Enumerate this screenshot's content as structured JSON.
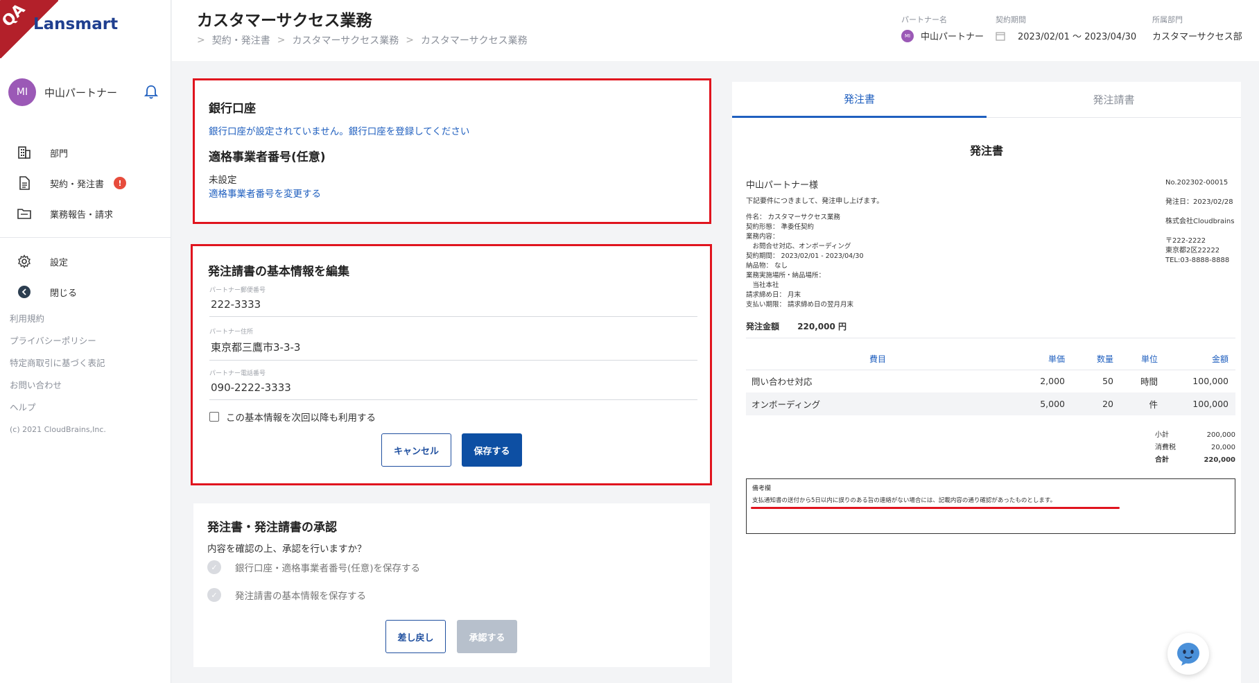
{
  "brand": {
    "qa_label": "QA",
    "logo": "Lansmart"
  },
  "user": {
    "initials": "MI",
    "name": "中山パートナー"
  },
  "nav": {
    "items": [
      {
        "label": "部門",
        "icon": "building-icon"
      },
      {
        "label": "契約・発注書",
        "icon": "document-icon",
        "badge": "!"
      },
      {
        "label": "業務報告・請求",
        "icon": "folder-icon"
      }
    ],
    "settings": "設定",
    "close": "閉じる"
  },
  "footer": {
    "links": [
      "利用規約",
      "プライバシーポリシー",
      "特定商取引に基づく表記",
      "お問い合わせ",
      "ヘルプ"
    ],
    "copyright": "(c) 2021 CloudBrains,Inc."
  },
  "header": {
    "title": "カスタマーサクセス業務",
    "breadcrumb": [
      "契約・発注書",
      "カスタマーサクセス業務",
      "カスタマーサクセス業務"
    ],
    "partner_label": "パートナー名",
    "partner_initials": "MI",
    "partner_value": "中山パートナー",
    "period_label": "契約期間",
    "period_value": "2023/02/01 〜 2023/04/30",
    "dept_label": "所属部門",
    "dept_value": "カスタマーサクセス部"
  },
  "bank_card": {
    "bank_title": "銀行口座",
    "bank_link": "銀行口座が設定されていません。銀行口座を登録してください",
    "invoice_title": "適格事業者番号(任意)",
    "invoice_status": "未設定",
    "invoice_link": "適格事業者番号を変更する"
  },
  "edit_card": {
    "title": "発注請書の基本情報を編集",
    "postal_label": "パートナー郵便番号",
    "postal_value": "222-3333",
    "address_label": "パートナー住所",
    "address_value": "東京都三鷹市3-3-3",
    "phone_label": "パートナー電話番号",
    "phone_value": "090-2222-3333",
    "reuse_label": "この基本情報を次回以降も利用する",
    "cancel_label": "キャンセル",
    "save_label": "保存する"
  },
  "approval_card": {
    "title": "発注書・発注請書の承認",
    "question": "内容を確認の上、承認を行いますか？",
    "steps": [
      "銀行口座・適格事業者番号(任意)を保存する",
      "発注請書の基本情報を保存する"
    ],
    "reject_label": "差し戻し",
    "approve_label": "承認する"
  },
  "document": {
    "tabs": [
      "発注書",
      "発注請書"
    ],
    "title": "発注書",
    "recipient": "中山パートナー様",
    "intro": "下記要件につきまして、発注申し上げます。",
    "details": [
      "件名：  カスタマーサクセス業務",
      "契約形態：  準委任契約",
      "業務内容：",
      "　お問合せ対応、オンボーディング",
      "契約期間：  2023/02/01 - 2023/04/30",
      "納品物：  なし",
      "業務実施場所・納品場所：",
      "　当社本社",
      "請求締め日：  月末",
      "支払い期限：  請求締め日の翌月月末"
    ],
    "amount_label": "発注金額",
    "amount_value": "220,000 円",
    "number": "No.202302-00015",
    "issue_date": "発注日：2023/02/28",
    "company": "株式会社Cloudbrains",
    "postal": "〒222-2222",
    "address": "東京都2区22222",
    "tel": "TEL:03-8888-8888",
    "table": {
      "headers": [
        "費目",
        "単価",
        "数量",
        "単位",
        "金額"
      ],
      "rows": [
        [
          "問い合わせ対応",
          "2,000",
          "50",
          "時間",
          "100,000"
        ],
        [
          "オンボーディング",
          "5,000",
          "20",
          "件",
          "100,000"
        ]
      ]
    },
    "subtotal_label": "小計",
    "subtotal_value": "200,000",
    "tax_label": "消費税",
    "tax_value": "20,000",
    "total_label": "合計",
    "total_value": "220,000",
    "remarks_label": "備考欄",
    "remarks_text": "支払通知書の送付から5日以内に誤りのある旨の連絡がない場合には、記載内容の通り確認があったものとします。"
  },
  "colors": {
    "accent": "#1f5fbf",
    "primary_button": "#0d4fa3",
    "highlight_frame": "#e0141e",
    "logo": "#1f3f8f"
  }
}
